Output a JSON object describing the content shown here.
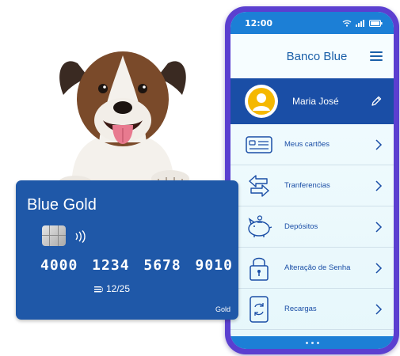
{
  "status_bar": {
    "time": "12:00"
  },
  "app": {
    "title": "Banco Blue"
  },
  "profile": {
    "name": "Maria José"
  },
  "menu": [
    {
      "label": "Meus cartões",
      "icon": "cards-icon"
    },
    {
      "label": "Tranferencias",
      "icon": "transfer-arrows-icon"
    },
    {
      "label": "Depósitos",
      "icon": "piggy-bank-icon"
    },
    {
      "label": "Alteração de Senha",
      "icon": "padlock-icon"
    },
    {
      "label": "Recargas",
      "icon": "phone-recharge-icon"
    }
  ],
  "card": {
    "title": "Blue Gold",
    "number": "4000 1234 5678 9010",
    "expiry": "12/25",
    "tier": "Gold"
  },
  "colors": {
    "phone_frame": "#5b3fd0",
    "primary_blue": "#1c7fd6",
    "dark_blue": "#1a4ea6",
    "card_blue": "#1f58a8",
    "avatar_yellow": "#f5b800"
  }
}
